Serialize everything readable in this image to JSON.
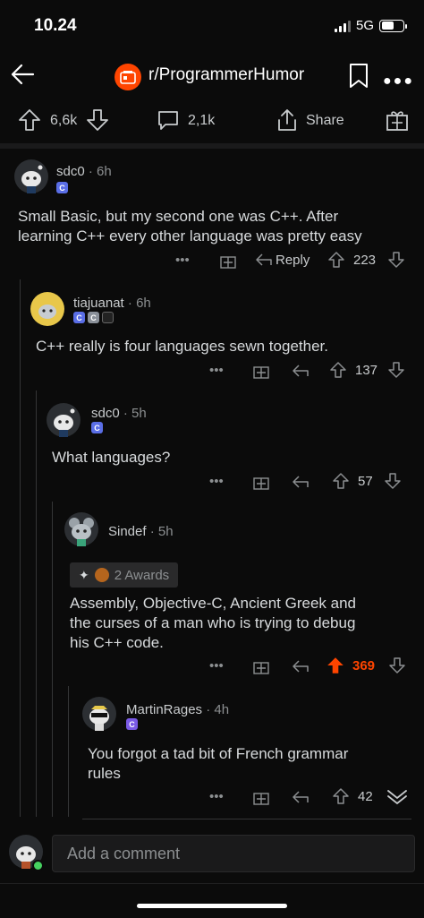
{
  "status": {
    "time": "10.24",
    "network": "5G"
  },
  "header": {
    "subreddit": "r/ProgrammerHumor"
  },
  "post_actions": {
    "upvotes": "6,6k",
    "comments": "2,1k",
    "share": "Share"
  },
  "comments": [
    {
      "user": "sdc0",
      "time": "6h",
      "flairs": [
        "C"
      ],
      "text_lines": [
        "Small Basic, but my second one was C++. After",
        "learning C++ every other language was pretty easy"
      ],
      "reply_label": "Reply",
      "score": "223"
    },
    {
      "user": "tiajuanat",
      "time": "6h",
      "flairs": [
        "C",
        "C"
      ],
      "text_lines": [
        "C++ really is four languages sewn together."
      ],
      "score": "137"
    },
    {
      "user": "sdc0",
      "time": "5h",
      "flairs": [
        "C"
      ],
      "text_lines": [
        "What languages?"
      ],
      "score": "57"
    },
    {
      "user": "Sindef",
      "time": "5h",
      "awards": "2 Awards",
      "text_lines": [
        "Assembly, Objective-C, Ancient Greek and",
        "the curses of a man who is trying to debug",
        "his C++ code."
      ],
      "score": "369"
    },
    {
      "user": "MartinRages",
      "time": "4h",
      "flairs": [
        "C"
      ],
      "text_lines": [
        "You forgot a tad bit of French grammar",
        "rules"
      ],
      "score": "42"
    }
  ],
  "composer": {
    "placeholder": "Add a comment"
  },
  "colors": {
    "accent": "#ff4500",
    "flair": "#5a6ee6",
    "background": "#0b0b0b"
  }
}
